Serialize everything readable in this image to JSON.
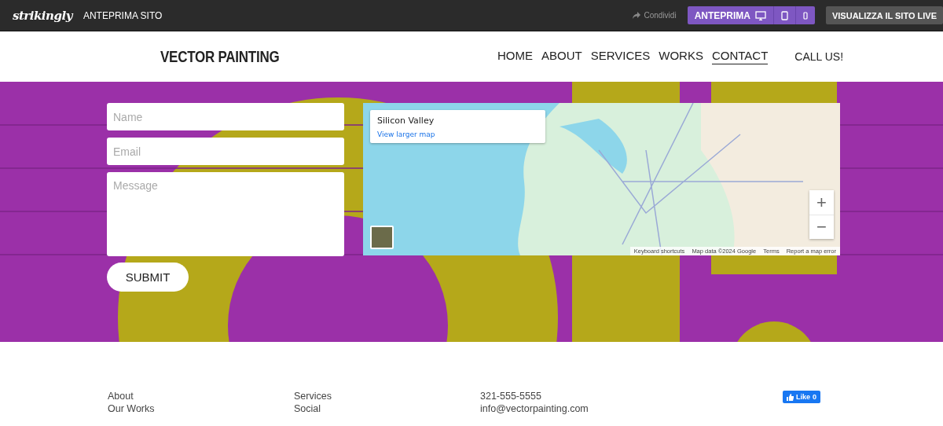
{
  "topbar": {
    "logo": "strikingly",
    "title": "ANTEPRIMA SITO",
    "share": "Condividi",
    "preview": "ANTEPRIMA",
    "live_button": "VISUALIZZA IL SITO LIVE"
  },
  "header": {
    "brand": "VECTOR PAINTING",
    "nav": [
      {
        "label": "HOME",
        "selected": false
      },
      {
        "label": "ABOUT",
        "selected": false
      },
      {
        "label": "SERVICES",
        "selected": false
      },
      {
        "label": "WORKS",
        "selected": false
      },
      {
        "label": "CONTACT",
        "selected": true
      }
    ],
    "call": "CALL US!"
  },
  "form": {
    "fields": [
      {
        "placeholder": "Name",
        "kind": "line"
      },
      {
        "placeholder": "Email",
        "kind": "line"
      },
      {
        "placeholder": "Message",
        "kind": "area"
      }
    ],
    "submit": "SUBMIT"
  },
  "map": {
    "place": "Silicon Valley",
    "link": "View larger map",
    "zoom_in": "+",
    "zoom_out": "−",
    "attribution": [
      "Keyboard shortcuts",
      "Map data ©2024 Google",
      "Terms",
      "Report a map error"
    ]
  },
  "footer": {
    "columns": [
      [
        "About",
        "Our Works"
      ],
      [
        "Services",
        "Social"
      ],
      [
        "321-555-5555",
        "info@vectorpainting.com"
      ]
    ],
    "like_label": "Like",
    "like_count": "0"
  }
}
